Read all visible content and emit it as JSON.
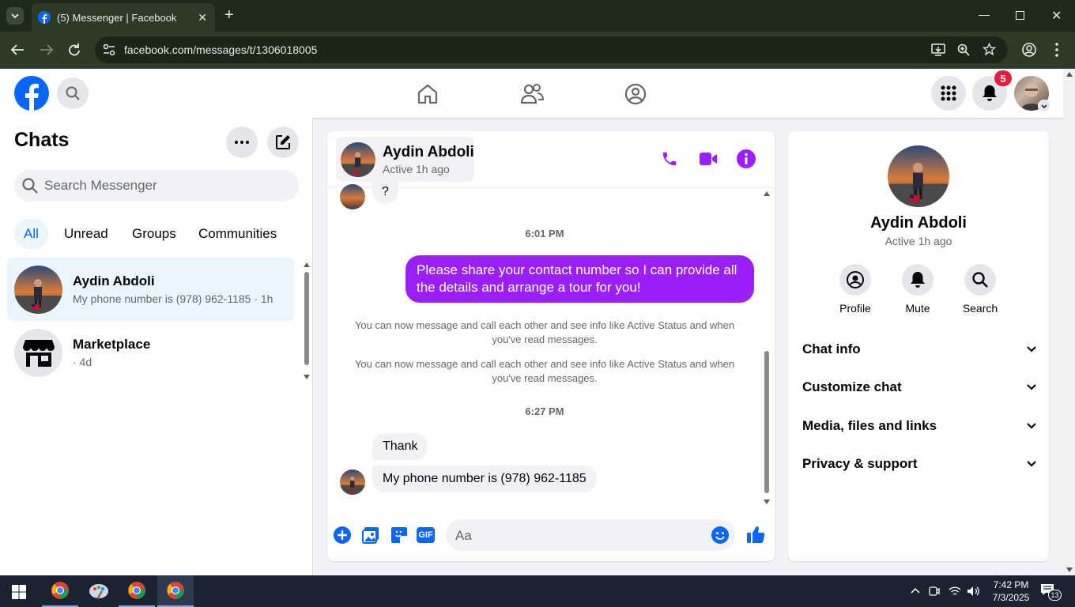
{
  "browser": {
    "tab_title": "(5) Messenger | Facebook",
    "url": "facebook.com/messages/t/1306018005"
  },
  "fb_nav": {
    "notification_count": "5"
  },
  "sidebar": {
    "title": "Chats",
    "search_placeholder": "Search Messenger",
    "filters": [
      "All",
      "Unread",
      "Groups",
      "Communities"
    ],
    "chats": [
      {
        "name": "Aydin Abdoli",
        "preview": "My phone number is (978) 962-1185 · 1h"
      },
      {
        "name": "Marketplace",
        "preview": "· 4d"
      }
    ]
  },
  "conversation": {
    "contact_name": "Aydin Abdoli",
    "contact_status": "Active 1h ago",
    "messages": {
      "q_mark": "?",
      "ts1": "6:01 PM",
      "outgoing": "Please share your contact number so I can provide all the details and arrange a tour for you!",
      "sys1": "You can now message and call each other and see info like Active Status and when you've read messages.",
      "sys2": "You can now message and call each other and see info like Active Status and when you've read messages.",
      "ts2": "6:27 PM",
      "in1": "Thank",
      "in2": "My phone number is (978) 962-1185"
    },
    "composer_placeholder": "Aa",
    "gif_label": "GIF"
  },
  "right_panel": {
    "name": "Aydin Abdoli",
    "status": "Active 1h ago",
    "actions": [
      "Profile",
      "Mute",
      "Search"
    ],
    "sections": [
      "Chat info",
      "Customize chat",
      "Media, files and links",
      "Privacy & support"
    ]
  },
  "taskbar": {
    "time": "7:42 PM",
    "date": "7/3/2025",
    "notif_count": "13"
  },
  "colors": {
    "fb_blue": "#0866ff",
    "messenger_purple": "#9b1ffb",
    "notification_red": "#e41e3f"
  }
}
